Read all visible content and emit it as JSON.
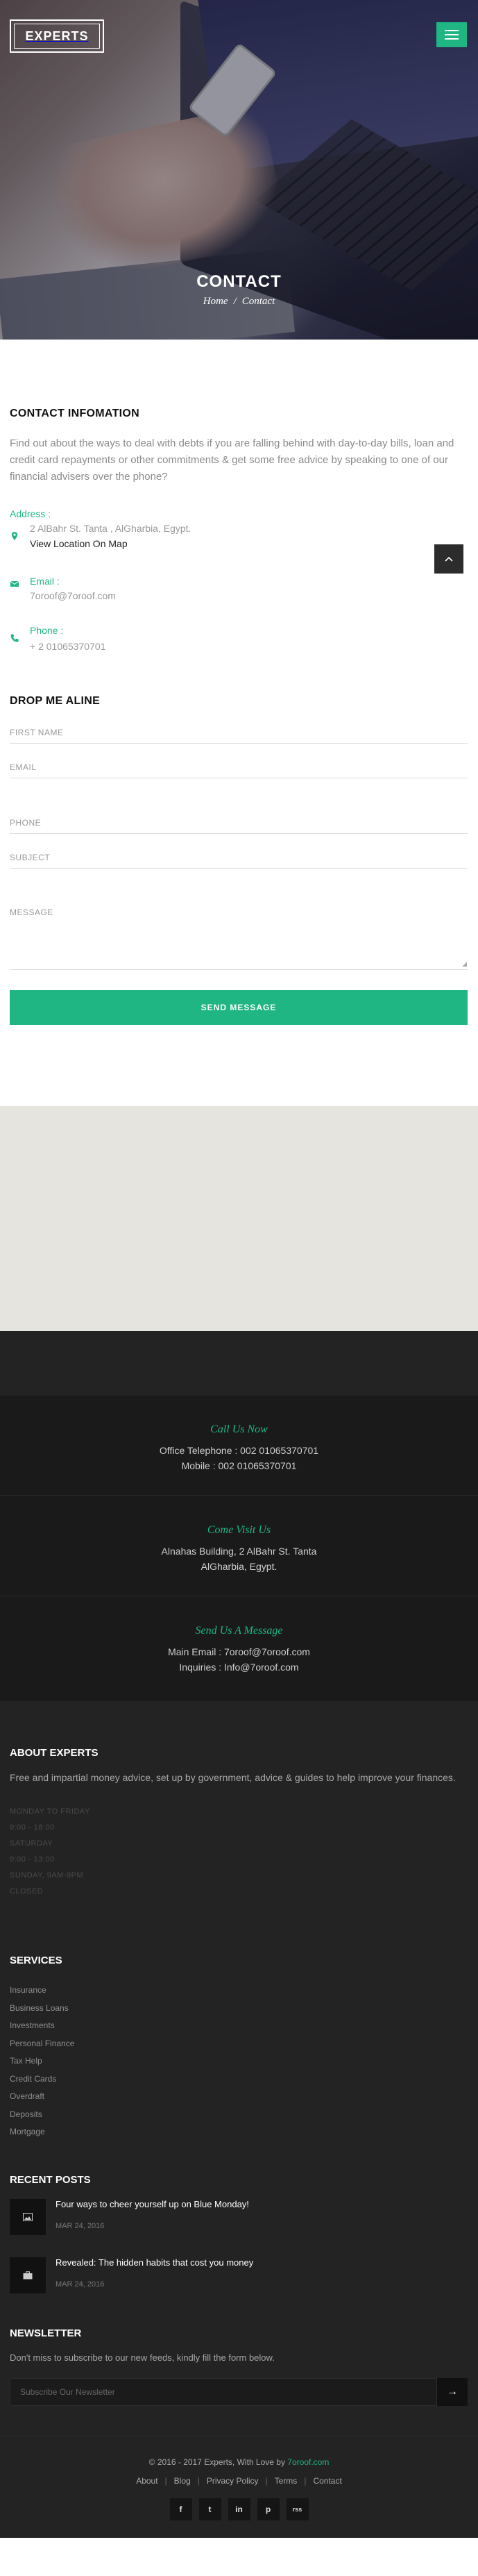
{
  "brand": {
    "logo_text": "EXPERTS"
  },
  "hero": {
    "title": "CONTACT",
    "crumb_home": "Home",
    "crumb_sep": "/",
    "crumb_current": "Contact"
  },
  "contact_info": {
    "title": "CONTACT INFOMATION",
    "intro": "Find out about the ways to deal with debts if you are falling behind with day-to-day bills, loan and credit card repayments or other commitments & get some free advice by speaking to one of our financial advisers over the phone?",
    "address_label": "Address :",
    "address_value": "2 AlBahr St. Tanta , AlGharbia, Egypt.",
    "map_link": "View Location On Map",
    "email_label": "Email :",
    "email_value": "7oroof@7oroof.com",
    "phone_label": "Phone :",
    "phone_value": "+ 2 01065370701"
  },
  "form": {
    "title": "DROP ME ALINE",
    "first_name": "FIRST NAME",
    "email": "EMAIL",
    "phone": "PHONE",
    "subject": "SUBJECT",
    "message": "MESSAGE",
    "send": "SEND MESSAGE"
  },
  "call_us": {
    "title": "Call Us Now",
    "line1": "Office Telephone : 002 01065370701",
    "line2": "Mobile : 002 01065370701"
  },
  "visit_us": {
    "title": "Come Visit Us",
    "line1": "Alnahas Building, 2 AlBahr St. Tanta",
    "line2": "AlGharbia, Egypt."
  },
  "message_us": {
    "title": "Send Us A Message",
    "line1": "Main Email : 7oroof@7oroof.com",
    "line2": "Inquiries : Info@7oroof.com"
  },
  "about": {
    "title": "ABOUT EXPERTS",
    "text": "Free and impartial money advice, set up by government, advice & guides to help improve your finances.",
    "hours": [
      "MONDAY TO FRIDAY",
      "9:00 - 18:00",
      "SATURDAY",
      "9:00 - 13:00",
      "SUNDAY, 9AM-9PM",
      "CLOSED"
    ]
  },
  "services": {
    "title": "SERVICES",
    "items": [
      "Insurance",
      "Business Loans",
      "Investments",
      "Personal Finance",
      "Tax Help",
      "Credit Cards",
      "Overdraft",
      "Deposits",
      "Mortgage"
    ]
  },
  "recent_posts": {
    "title": "RECENT POSTS",
    "items": [
      {
        "title": "Four ways to cheer yourself up on Blue Monday!",
        "date": "MAR 24, 2016"
      },
      {
        "title": "Revealed: The hidden habits that cost you money",
        "date": "MAR 24, 2016"
      }
    ]
  },
  "newsletter": {
    "title": "NEWSLETTER",
    "text": "Don't miss to subscribe to our new feeds, kindly fill the form below.",
    "placeholder": "Subscribe Our Newsletter",
    "button": "→"
  },
  "bottom": {
    "copyright": "© 2016 - 2017 Experts, With Love by",
    "copyright_link": "7oroof.com",
    "links": [
      "About",
      "Blog",
      "Privacy Policy",
      "Terms",
      "Contact"
    ],
    "separator": "|",
    "socials": [
      "f",
      "t",
      "in",
      "p",
      "rss"
    ]
  },
  "colors": {
    "accent": "#1fb683",
    "dark": "#232323",
    "darker": "#1a1a1a",
    "map_bg": "#e6e4df"
  },
  "icons": {
    "location": "map-pin-icon",
    "email": "envelope-icon",
    "phone": "phone-icon",
    "menu": "hamburger-icon",
    "scroll": "chevron-up-icon"
  }
}
